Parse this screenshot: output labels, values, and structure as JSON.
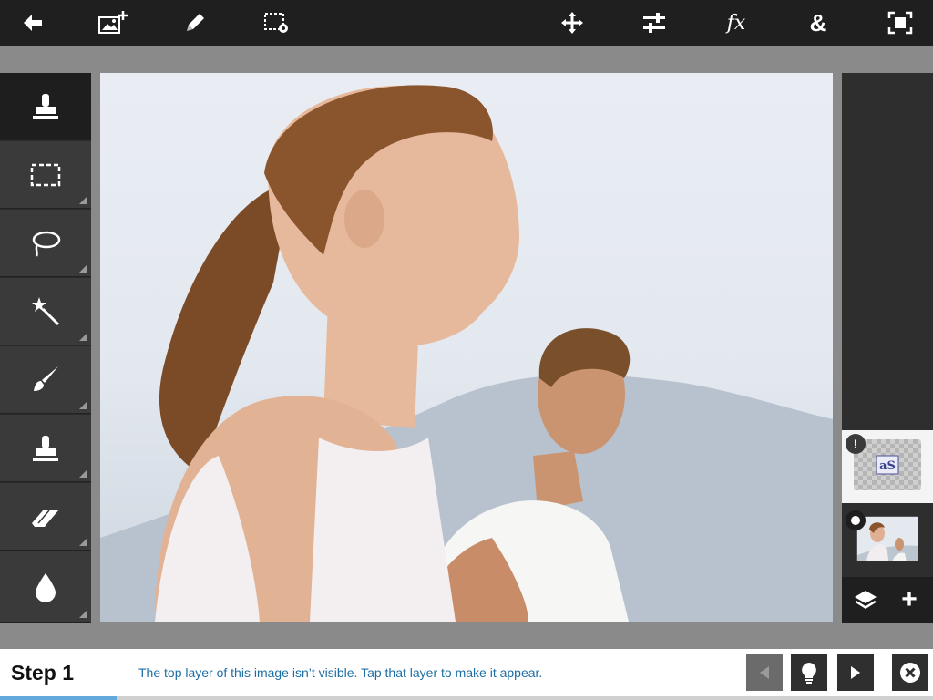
{
  "toolbar": {
    "icons": [
      "back-arrow-icon",
      "add-image-icon",
      "pencil-icon",
      "selection-settings-icon",
      "move-icon",
      "adjustments-icon",
      "effects-icon",
      "ampersand-icon",
      "fit-screen-icon"
    ],
    "fx_label": "fx",
    "amp_label": "&"
  },
  "tools": {
    "items": [
      {
        "name": "stamp",
        "icon": "stamp-icon",
        "active": true
      },
      {
        "name": "rect-select",
        "icon": "rect-select-icon"
      },
      {
        "name": "lasso",
        "icon": "lasso-icon"
      },
      {
        "name": "magic-wand",
        "icon": "magic-wand-icon"
      },
      {
        "name": "brush",
        "icon": "brush-icon"
      },
      {
        "name": "clone-stamp",
        "icon": "clone-stamp-icon"
      },
      {
        "name": "eraser",
        "icon": "eraser-icon"
      },
      {
        "name": "drop",
        "icon": "drop-icon"
      }
    ]
  },
  "canvas": {
    "image": "photo of a woman with ponytail in white tank top and a man in background"
  },
  "layers": {
    "top_layer": {
      "badge": "!",
      "icon": "text-layer-icon"
    },
    "bottom_layer": {
      "icon": "photo-layer-icon"
    },
    "footer_icons": [
      "layers-icon",
      "add-layer-icon"
    ],
    "add_label": "+"
  },
  "step": {
    "title": "Step 1",
    "instruction": "The top layer of this image isn’t visible. Tap that layer to make it appear.",
    "progress": 0.125
  },
  "colors": {
    "toolbar": "#1f1f1f",
    "instruction_text": "#1c6ea4",
    "progress": "#63a9dc"
  }
}
